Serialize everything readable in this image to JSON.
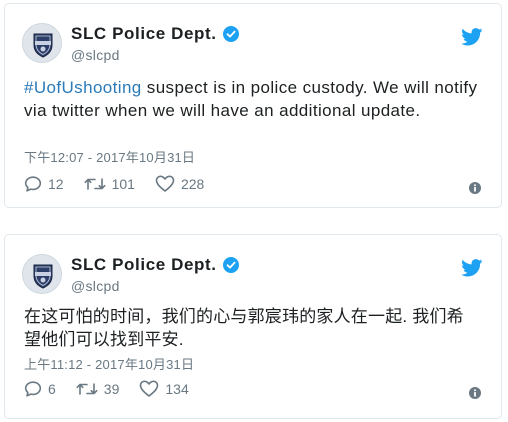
{
  "tweets": [
    {
      "author": {
        "name": "SLC Police Dept.",
        "handle": "@slcpd",
        "avatar_text": "SALT LAKE CITY POLICE"
      },
      "hashtag": "#UofUshooting",
      "text": " suspect is in police custody. We will notify via twitter when we will have an additional update.",
      "timestamp": "下午12:07 - 2017年10月31日",
      "replies": "12",
      "retweets": "101",
      "likes": "228"
    },
    {
      "author": {
        "name": "SLC Police Dept.",
        "handle": "@slcpd",
        "avatar_text": "SALT LAKE CITY POLICE"
      },
      "hashtag": "",
      "text": "在这可怕的时间，我们的心与郭宸玮的家人在一起. 我们希望他们可以找到平安.",
      "timestamp": "上午11:12 - 2017年10月31日",
      "replies": "6",
      "retweets": "39",
      "likes": "134"
    }
  ],
  "colors": {
    "accent": "#1da1f2",
    "hashtag": "#2b7bb9",
    "muted": "#697882",
    "border": "#e1e8ed"
  },
  "icons": [
    "verified-icon",
    "twitter-logo-icon",
    "reply-icon",
    "retweet-icon",
    "like-icon",
    "info-icon"
  ]
}
